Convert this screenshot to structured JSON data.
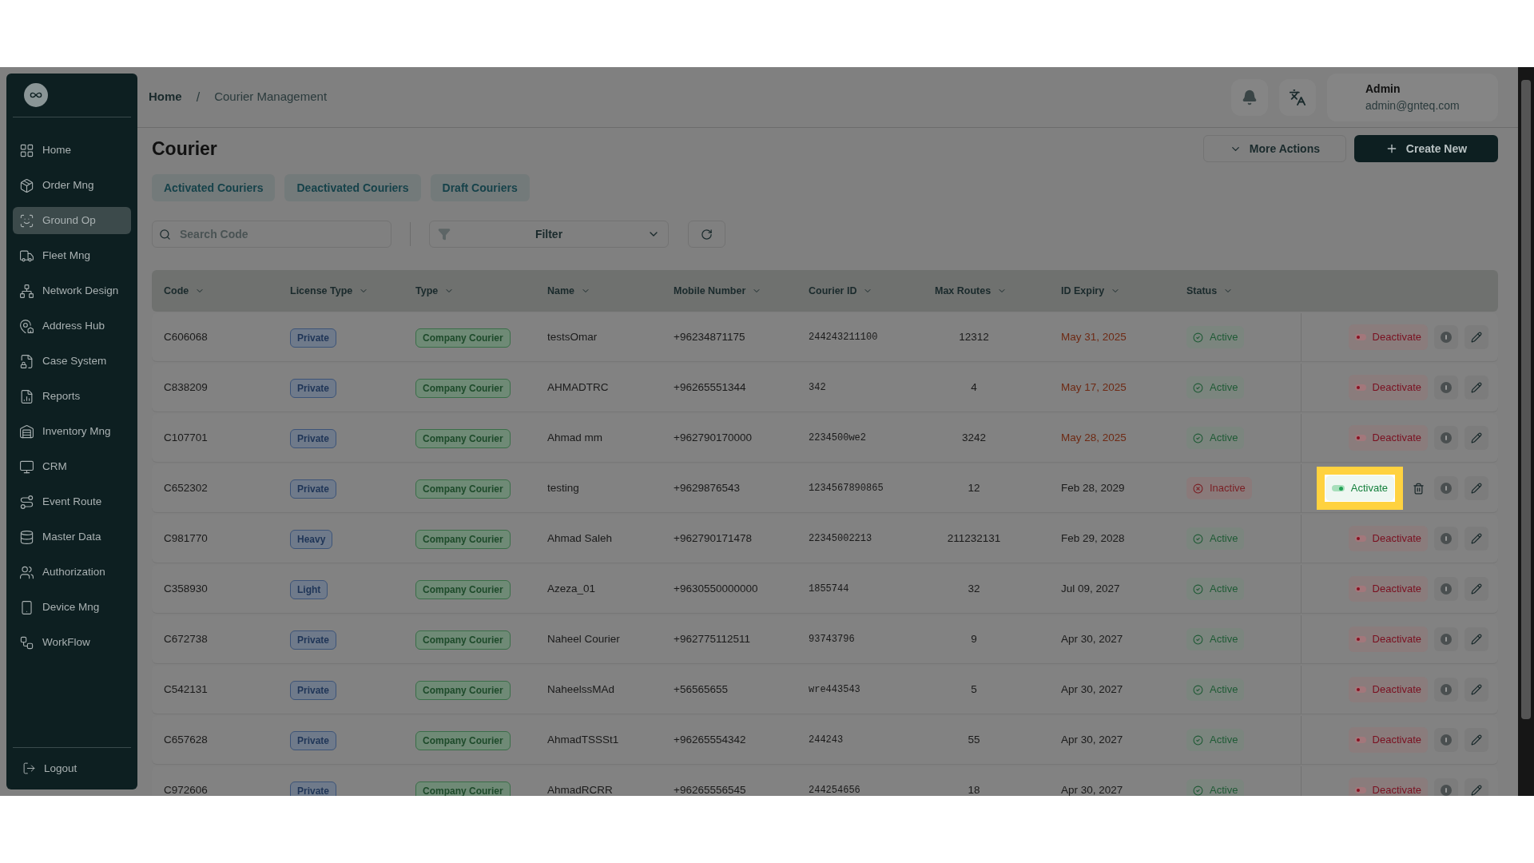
{
  "sidebar": {
    "items": [
      {
        "label": "Home",
        "selected": false
      },
      {
        "label": "Order Mng",
        "selected": false
      },
      {
        "label": "Ground Op",
        "selected": true
      },
      {
        "label": "Fleet Mng",
        "selected": false
      },
      {
        "label": "Network Design",
        "selected": false
      },
      {
        "label": "Address Hub",
        "selected": false
      },
      {
        "label": "Case System",
        "selected": false
      },
      {
        "label": "Reports",
        "selected": false
      },
      {
        "label": "Inventory Mng",
        "selected": false
      },
      {
        "label": "CRM",
        "selected": false
      },
      {
        "label": "Event Route",
        "selected": false
      },
      {
        "label": "Master Data",
        "selected": false
      },
      {
        "label": "Authorization",
        "selected": false
      },
      {
        "label": "Device Mng",
        "selected": false
      },
      {
        "label": "WorkFlow",
        "selected": false
      }
    ],
    "logout": "Logout"
  },
  "header": {
    "breadcrumb": [
      "Home",
      "Courier Management"
    ],
    "breadcrumb_separator": "/",
    "user": {
      "name": "Admin",
      "email": "admin@gnteq.com"
    }
  },
  "page": {
    "title": "Courier",
    "more_actions": "More Actions",
    "create_new": "Create New"
  },
  "tabs": [
    "Activated Couriers",
    "Deactivated Couriers",
    "Draft Couriers"
  ],
  "search": {
    "placeholder": "Search Code"
  },
  "filter": {
    "label": "Filter"
  },
  "table": {
    "columns": [
      "Code",
      "License Type",
      "Type",
      "Name",
      "Mobile Number",
      "Courier ID",
      "Max Routes",
      "ID Expiry",
      "Status"
    ],
    "rows": [
      {
        "code": "C606068",
        "license": "Private",
        "type": "Company Courier",
        "name": "testsOmar",
        "mobile": "+96234871175",
        "courier_id": "244243211100",
        "max_routes": "12312",
        "id_expiry": "May 31, 2025",
        "expired": true,
        "status": {
          "label": "Active",
          "kind": "active"
        },
        "action": {
          "label": "Deactivate",
          "kind": "deactivate"
        }
      },
      {
        "code": "C838209",
        "license": "Private",
        "type": "Company Courier",
        "name": "AHMADTRC",
        "mobile": "+96265551344",
        "courier_id": "342",
        "max_routes": "4",
        "id_expiry": "May 17, 2025",
        "expired": true,
        "status": {
          "label": "Active",
          "kind": "active"
        },
        "action": {
          "label": "Deactivate",
          "kind": "deactivate"
        }
      },
      {
        "code": "C107701",
        "license": "Private",
        "type": "Company Courier",
        "name": "Ahmad mm",
        "mobile": "+962790170000",
        "courier_id": "2234500we2",
        "max_routes": "3242",
        "id_expiry": "May 28, 2025",
        "expired": true,
        "status": {
          "label": "Active",
          "kind": "active"
        },
        "action": {
          "label": "Deactivate",
          "kind": "deactivate"
        }
      },
      {
        "code": "C652302",
        "license": "Private",
        "type": "Company Courier",
        "name": "testing",
        "mobile": "+9629876543",
        "courier_id": "1234567890865",
        "max_routes": "12",
        "id_expiry": "Feb 28, 2029",
        "expired": false,
        "status": {
          "label": "Inactive",
          "kind": "inactive"
        },
        "action": {
          "label": "Activate",
          "kind": "activate"
        }
      },
      {
        "code": "C981770",
        "license": "Heavy",
        "type": "Company Courier",
        "name": "Ahmad Saleh",
        "mobile": "+962790171478",
        "courier_id": "22345002213",
        "max_routes": "211232131",
        "id_expiry": "Feb 29, 2028",
        "expired": false,
        "status": {
          "label": "Active",
          "kind": "active"
        },
        "action": {
          "label": "Deactivate",
          "kind": "deactivate"
        }
      },
      {
        "code": "C358930",
        "license": "Light",
        "type": "Company Courier",
        "name": "Azeza_01",
        "mobile": "+9630550000000",
        "courier_id": "1855744",
        "max_routes": "32",
        "id_expiry": "Jul 09, 2027",
        "expired": false,
        "status": {
          "label": "Active",
          "kind": "active"
        },
        "action": {
          "label": "Deactivate",
          "kind": "deactivate"
        }
      },
      {
        "code": "C672738",
        "license": "Private",
        "type": "Company Courier",
        "name": "Naheel Courier",
        "mobile": "+962775112511",
        "courier_id": "93743796",
        "max_routes": "9",
        "id_expiry": "Apr 30, 2027",
        "expired": false,
        "status": {
          "label": "Active",
          "kind": "active"
        },
        "action": {
          "label": "Deactivate",
          "kind": "deactivate"
        }
      },
      {
        "code": "C542131",
        "license": "Private",
        "type": "Company Courier",
        "name": "NaheelssMAd",
        "mobile": "+56565655",
        "courier_id": "wre443543",
        "max_routes": "5",
        "id_expiry": "Apr 30, 2027",
        "expired": false,
        "status": {
          "label": "Active",
          "kind": "active"
        },
        "action": {
          "label": "Deactivate",
          "kind": "deactivate"
        }
      },
      {
        "code": "C657628",
        "license": "Private",
        "type": "Company Courier",
        "name": "AhmadTSSSt1",
        "mobile": "+96265554342",
        "courier_id": "244243",
        "max_routes": "55",
        "id_expiry": "Apr 30, 2027",
        "expired": false,
        "status": {
          "label": "Active",
          "kind": "active"
        },
        "action": {
          "label": "Deactivate",
          "kind": "deactivate"
        }
      },
      {
        "code": "C972606",
        "license": "Private",
        "type": "Company Courier",
        "name": "AhmadRCRR",
        "mobile": "+96265556545",
        "courier_id": "244254656",
        "max_routes": "18",
        "id_expiry": "Apr 30, 2027",
        "expired": false,
        "status": {
          "label": "Active",
          "kind": "active"
        },
        "action": {
          "label": "Deactivate",
          "kind": "deactivate"
        }
      }
    ]
  }
}
